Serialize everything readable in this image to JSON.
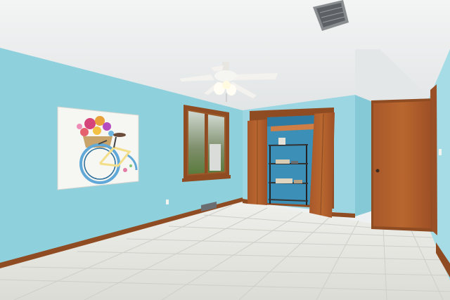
{
  "scene": {
    "kind": "photo",
    "subject": "empty-bedroom",
    "features": [
      "textured-ceiling",
      "ceiling-fan",
      "air-vent",
      "bicycle-wall-art",
      "window",
      "open-bifold-closet",
      "closet-shelving-unit",
      "wood-door",
      "tile-floor",
      "baseboard-trim"
    ]
  },
  "colors": {
    "ceiling": "#eceeee",
    "wall_left": "#8fd0dd",
    "wall_back": "#9bd6e2",
    "wall_right": "#a6dce6",
    "wood": "#b2612c",
    "wood_dark": "#8a4a22",
    "trim": "#8f4c22",
    "floor": "#e7e7e3",
    "grout": "#cfcfc9",
    "fan": "#f3f2ee"
  }
}
